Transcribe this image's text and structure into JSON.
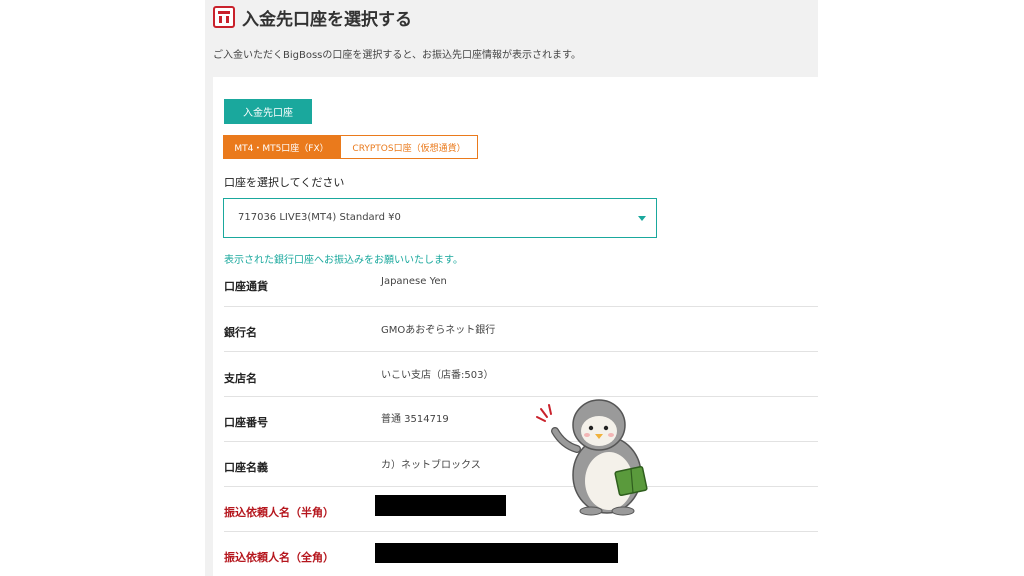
{
  "header": {
    "title": "入金先口座を選択する",
    "description": "ご入金いただくBigBossの口座を選択すると、お振込先口座情報が表示されます。"
  },
  "section": {
    "button_label": "入金先口座"
  },
  "tabs": [
    {
      "label": "MT4・MT5口座（FX）",
      "active": true
    },
    {
      "label": "CRYPTOS口座（仮想通貨）",
      "active": false
    }
  ],
  "account_select": {
    "label": "口座を選択してください",
    "selected_value": "717036 LIVE3(MT4) Standard ¥0"
  },
  "notice": "表示された銀行口座へお振込みをお願いいたします。",
  "bank_info": [
    {
      "label": "口座通貨",
      "value": "Japanese Yen"
    },
    {
      "label": "銀行名",
      "value": "GMOあおぞらネット銀行"
    },
    {
      "label": "支店名",
      "value": "いこい支店（店番:503）"
    },
    {
      "label": "口座番号",
      "value": "普通 3514719"
    },
    {
      "label": "口座名義",
      "value": "カ）ネットブロックス"
    },
    {
      "label": "振込依頼人名（半角）",
      "value": ""
    },
    {
      "label": "振込依頼人名（全角）",
      "value": ""
    }
  ],
  "colors": {
    "accent_teal": "#1aa89d",
    "tab_orange": "#ea7a1c",
    "required_red": "#b5161d"
  },
  "icons": {
    "title_icon": "bank-icon",
    "caret": "caret-down-icon"
  }
}
